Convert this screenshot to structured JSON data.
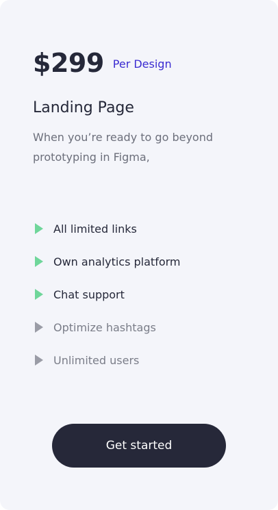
{
  "pricing": {
    "price": "$299",
    "unit": "Per Design",
    "title": "Landing Page",
    "description": "When you’re ready to go beyond prototyping in Figma,"
  },
  "features": [
    {
      "label": "All limited links",
      "enabled": true
    },
    {
      "label": "Own analytics platform",
      "enabled": true
    },
    {
      "label": "Chat support",
      "enabled": true
    },
    {
      "label": "Optimize hashtags",
      "enabled": false
    },
    {
      "label": "Unlimited users",
      "enabled": false
    }
  ],
  "cta": {
    "label": "Get started"
  },
  "colors": {
    "card_background": "#f4f5fa",
    "accent": "#3a2bd1",
    "enabled_icon": "#6fd69a",
    "disabled_icon": "#9a9ca6",
    "button": "#262839"
  },
  "icons": {
    "enabled": "play-triangle-icon",
    "disabled": "play-triangle-icon"
  }
}
